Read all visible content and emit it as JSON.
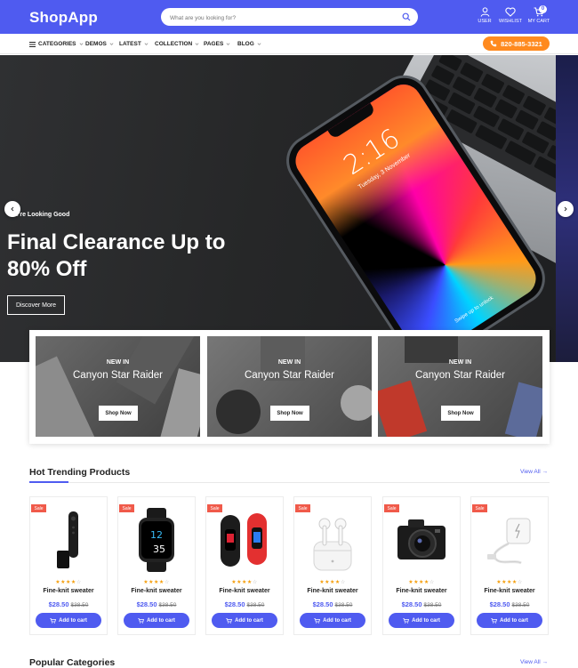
{
  "header": {
    "logo": "ShopApp",
    "search_placeholder": "What are you looking for?",
    "user_label": "USER",
    "wishlist_label": "WISHLIST",
    "cart_label": "MY CART",
    "cart_count": "0"
  },
  "nav": {
    "items": [
      {
        "label": "CATEGORIES"
      },
      {
        "label": "DEMOS"
      },
      {
        "label": "LATEST"
      },
      {
        "label": "COLLECTION"
      },
      {
        "label": "PAGES"
      },
      {
        "label": "BLOG"
      }
    ],
    "phone": "820-885-3321"
  },
  "hero": {
    "kicker": "You're Looking Good",
    "title": "Final Clearance Up to 80% Off",
    "button": "Discover More",
    "phone_time": "2:16",
    "phone_date": "Tuesday, 3 November",
    "phone_swipe": "Swipe up to unlock"
  },
  "promos": [
    {
      "badge": "NEW IN",
      "name": "Canyon Star Raider",
      "button": "Shop Now"
    },
    {
      "badge": "NEW IN",
      "name": "Canyon Star Raider",
      "button": "Shop Now"
    },
    {
      "badge": "NEW IN",
      "name": "Canyon Star Raider",
      "button": "Shop Now"
    }
  ],
  "trending": {
    "title": "Hot Trending Products",
    "view_all": "View All →",
    "products": [
      {
        "sale": "Sale",
        "name": "Fine-knit sweater",
        "price": "$28.50",
        "old_price": "$38.50",
        "rating": 4,
        "button": "Add to cart",
        "icon": "tv-stick"
      },
      {
        "sale": "Sale",
        "name": "Fine-knit sweater",
        "price": "$28.50",
        "old_price": "$38.50",
        "rating": 4,
        "button": "Add to cart",
        "icon": "smartwatch"
      },
      {
        "sale": "Sale",
        "name": "Fine-knit sweater",
        "price": "$28.50",
        "old_price": "$38.50",
        "rating": 4,
        "button": "Add to cart",
        "icon": "fitness-bands"
      },
      {
        "sale": "Sale",
        "name": "Fine-knit sweater",
        "price": "$28.50",
        "old_price": "$38.50",
        "rating": 4,
        "button": "Add to cart",
        "icon": "earbuds"
      },
      {
        "sale": "Sale",
        "name": "Fine-knit sweater",
        "price": "$28.50",
        "old_price": "$38.50",
        "rating": 4,
        "button": "Add to cart",
        "icon": "camera"
      },
      {
        "sale": "Sale",
        "name": "Fine-knit sweater",
        "price": "$28.50",
        "old_price": "$38.50",
        "rating": 4,
        "button": "Add to cart",
        "icon": "charger"
      }
    ]
  },
  "next_section": {
    "title": "Popular Categories",
    "link": "View All →"
  },
  "colors": {
    "brand": "#4f5bf0",
    "accent_orange": "#ff8a1f",
    "sale_red": "#f05a4a",
    "star": "#f59e0b"
  }
}
